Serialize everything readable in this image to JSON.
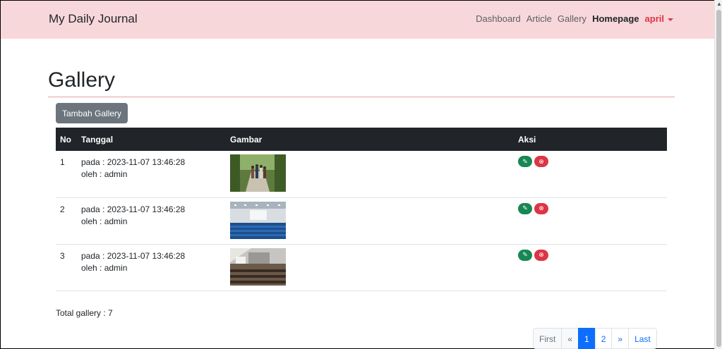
{
  "navbar": {
    "brand": "My Daily Journal",
    "links": [
      {
        "label": "Dashboard"
      },
      {
        "label": "Article"
      },
      {
        "label": "Gallery"
      },
      {
        "label": "Homepage"
      }
    ],
    "user": "april"
  },
  "page": {
    "title": "Gallery",
    "add_button": "Tambah Gallery",
    "total_text": "Total gallery : 7"
  },
  "table": {
    "headers": {
      "no": "No",
      "date": "Tanggal",
      "image": "Gambar",
      "action": "Aksi"
    },
    "rows": [
      {
        "no": "1",
        "date": "pada : 2023-11-07 13:46:28",
        "by": "oleh : admin",
        "image": "outdoor-path-people"
      },
      {
        "no": "2",
        "date": "pada : 2023-11-07 13:46:28",
        "by": "oleh : admin",
        "image": "auditorium-blue-seats"
      },
      {
        "no": "3",
        "date": "pada : 2023-11-07 13:46:28",
        "by": "oleh : admin",
        "image": "lecture-hall"
      }
    ]
  },
  "pagination": {
    "first": "First",
    "prev": "«",
    "pages": [
      "1",
      "2"
    ],
    "current": "1",
    "next": "»",
    "last": "Last"
  },
  "colors": {
    "navbar_bg": "#f8d7da",
    "user_accent": "#dc3545",
    "edit": "#198754",
    "delete": "#dc3545",
    "primary": "#0d6efd"
  },
  "icons": {
    "edit": "pencil-icon",
    "delete": "x-circle-icon",
    "caret": "caret-down-icon"
  }
}
